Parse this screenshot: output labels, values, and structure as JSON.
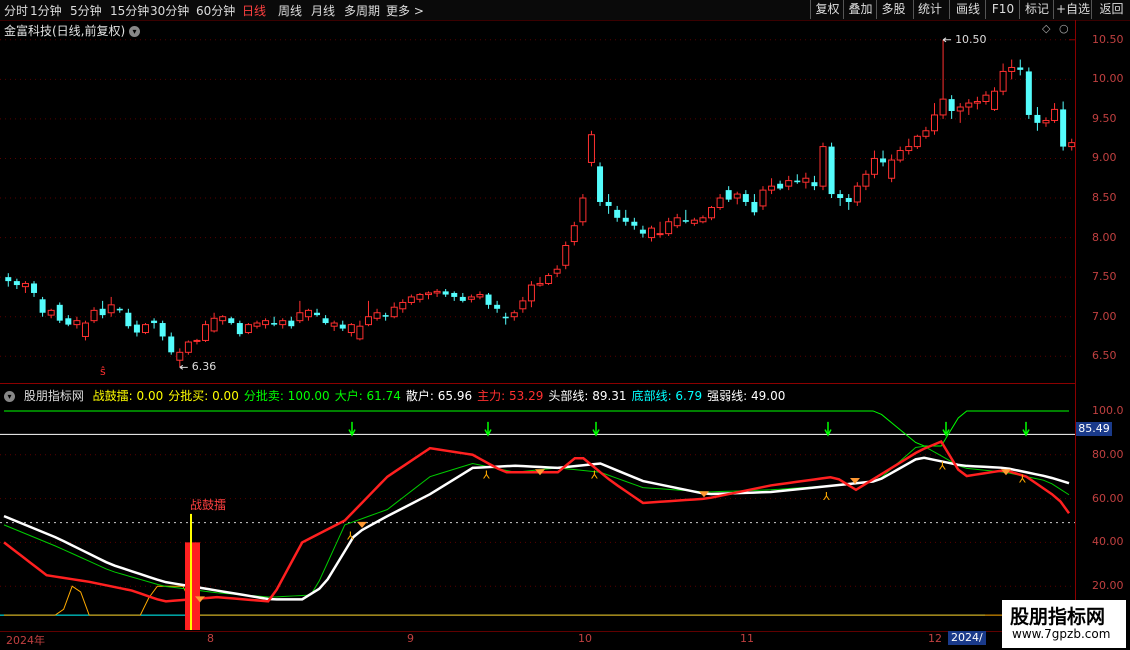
{
  "toolbar": {
    "timeframes": [
      "分时",
      "1分钟",
      "5分钟",
      "15分钟",
      "30分钟",
      "60分钟",
      "日线",
      "周线",
      "月线",
      "多周期",
      "更多 >"
    ],
    "active": "日线",
    "right_buttons": [
      "复权",
      "叠加",
      "多股",
      "统计",
      "画线",
      "F10",
      "标记",
      "+自选",
      "返回"
    ]
  },
  "stock": {
    "title": "金富科技(日线,前复权)",
    "toggle_icon": "chevron-down-icon"
  },
  "price_axis": [
    "10.50",
    "10.00",
    "9.50",
    "9.00",
    "8.50",
    "8.00",
    "7.50",
    "7.00",
    "6.50"
  ],
  "price_annotations": {
    "high": "10.50",
    "low": "6.36"
  },
  "indicator": {
    "name": "股朋指标网",
    "fields": [
      {
        "label": "战鼓擂:",
        "value": "0.00",
        "color": "#ffff00"
      },
      {
        "label": "分批买:",
        "value": "0.00",
        "color": "#ffff00"
      },
      {
        "label": "分批卖:",
        "value": "100.00",
        "color": "#00ff00"
      },
      {
        "label": "大户:",
        "value": "61.74",
        "color": "#00ff00"
      },
      {
        "label": "散户:",
        "value": "65.96",
        "color": "#ffffff"
      },
      {
        "label": "主力:",
        "value": "53.29",
        "color": "#ff3030"
      },
      {
        "label": "头部线:",
        "value": "89.31",
        "color": "#ffffff"
      },
      {
        "label": "底部线:",
        "value": "6.79",
        "color": "#00ffff"
      },
      {
        "label": "强弱线:",
        "value": "49.00",
        "color": "#ffffff"
      }
    ],
    "zhangulei_label": "战鼓擂"
  },
  "indicator_axis": [
    "100.0",
    "80.00",
    "60.00",
    "40.00",
    "20.00"
  ],
  "current_value_badge": "85.49",
  "date_axis": {
    "year": "2024年",
    "months": [
      "8",
      "9",
      "10",
      "11",
      "12"
    ],
    "year_end": "2024/"
  },
  "watermark": {
    "title": "股朋指标网",
    "url": "www.7gpzb.com"
  },
  "colors": {
    "up": "#ff3030",
    "down": "#54fcfc",
    "bg": "#000000",
    "grid": "#8b0000"
  },
  "chart_data": {
    "type": "candlestick",
    "ohlc": [
      [
        7.5,
        7.55,
        7.38,
        7.45
      ],
      [
        7.45,
        7.48,
        7.35,
        7.4
      ],
      [
        7.38,
        7.45,
        7.3,
        7.42
      ],
      [
        7.42,
        7.45,
        7.25,
        7.3
      ],
      [
        7.22,
        7.25,
        7.0,
        7.05
      ],
      [
        7.02,
        7.1,
        6.98,
        7.08
      ],
      [
        7.15,
        7.18,
        6.92,
        6.95
      ],
      [
        6.98,
        7.02,
        6.88,
        6.9
      ],
      [
        6.9,
        7.0,
        6.85,
        6.95
      ],
      [
        6.75,
        6.95,
        6.7,
        6.92
      ],
      [
        6.95,
        7.12,
        6.92,
        7.08
      ],
      [
        7.1,
        7.2,
        6.98,
        7.02
      ],
      [
        7.05,
        7.25,
        7.0,
        7.15
      ],
      [
        7.1,
        7.12,
        7.05,
        7.08
      ],
      [
        7.05,
        7.1,
        6.85,
        6.88
      ],
      [
        6.9,
        6.95,
        6.75,
        6.8
      ],
      [
        6.8,
        6.92,
        6.78,
        6.9
      ],
      [
        6.95,
        6.98,
        6.85,
        6.92
      ],
      [
        6.92,
        6.95,
        6.7,
        6.75
      ],
      [
        6.75,
        6.8,
        6.52,
        6.55
      ],
      [
        6.45,
        6.6,
        6.36,
        6.55
      ],
      [
        6.55,
        6.7,
        6.52,
        6.68
      ],
      [
        6.7,
        6.72,
        6.65,
        6.7
      ],
      [
        6.7,
        6.95,
        6.68,
        6.9
      ],
      [
        6.82,
        7.05,
        6.8,
        6.98
      ],
      [
        6.95,
        7.02,
        6.9,
        7.0
      ],
      [
        6.98,
        7.0,
        6.9,
        6.92
      ],
      [
        6.92,
        6.95,
        6.75,
        6.78
      ],
      [
        6.8,
        6.92,
        6.78,
        6.9
      ],
      [
        6.88,
        6.95,
        6.85,
        6.92
      ],
      [
        6.9,
        6.98,
        6.85,
        6.95
      ],
      [
        6.92,
        7.0,
        6.88,
        6.9
      ],
      [
        6.9,
        6.98,
        6.85,
        6.95
      ],
      [
        6.95,
        7.0,
        6.85,
        6.88
      ],
      [
        6.95,
        7.2,
        6.92,
        7.05
      ],
      [
        7.0,
        7.1,
        6.95,
        7.08
      ],
      [
        7.05,
        7.1,
        7.0,
        7.02
      ],
      [
        6.98,
        7.02,
        6.9,
        6.92
      ],
      [
        6.88,
        6.95,
        6.82,
        6.92
      ],
      [
        6.9,
        6.95,
        6.82,
        6.85
      ],
      [
        6.8,
        6.92,
        6.75,
        6.9
      ],
      [
        6.72,
        6.95,
        6.7,
        6.88
      ],
      [
        6.9,
        7.2,
        6.88,
        7.0
      ],
      [
        6.98,
        7.1,
        6.95,
        7.05
      ],
      [
        7.02,
        7.05,
        6.95,
        7.0
      ],
      [
        7.0,
        7.18,
        6.98,
        7.12
      ],
      [
        7.1,
        7.22,
        7.05,
        7.18
      ],
      [
        7.18,
        7.28,
        7.15,
        7.25
      ],
      [
        7.22,
        7.3,
        7.18,
        7.28
      ],
      [
        7.28,
        7.32,
        7.22,
        7.3
      ],
      [
        7.3,
        7.35,
        7.25,
        7.32
      ],
      [
        7.32,
        7.35,
        7.25,
        7.28
      ],
      [
        7.3,
        7.32,
        7.2,
        7.25
      ],
      [
        7.25,
        7.3,
        7.18,
        7.2
      ],
      [
        7.22,
        7.28,
        7.18,
        7.25
      ],
      [
        7.25,
        7.32,
        7.22,
        7.28
      ],
      [
        7.28,
        7.3,
        7.1,
        7.15
      ],
      [
        7.15,
        7.2,
        7.05,
        7.1
      ],
      [
        7.0,
        7.05,
        6.9,
        6.98
      ],
      [
        7.0,
        7.08,
        6.95,
        7.05
      ],
      [
        7.1,
        7.25,
        7.05,
        7.2
      ],
      [
        7.2,
        7.45,
        7.12,
        7.4
      ],
      [
        7.4,
        7.5,
        7.38,
        7.42
      ],
      [
        7.42,
        7.55,
        7.4,
        7.52
      ],
      [
        7.55,
        7.65,
        7.5,
        7.6
      ],
      [
        7.65,
        7.95,
        7.6,
        7.9
      ],
      [
        7.95,
        8.2,
        7.9,
        8.15
      ],
      [
        8.2,
        8.55,
        8.15,
        8.5
      ],
      [
        8.95,
        9.35,
        8.9,
        9.3
      ],
      [
        8.9,
        8.95,
        8.4,
        8.45
      ],
      [
        8.45,
        8.55,
        8.3,
        8.4
      ],
      [
        8.35,
        8.4,
        8.2,
        8.25
      ],
      [
        8.25,
        8.35,
        8.15,
        8.2
      ],
      [
        8.2,
        8.25,
        8.1,
        8.15
      ],
      [
        8.1,
        8.15,
        8.0,
        8.05
      ],
      [
        8.0,
        8.15,
        7.95,
        8.12
      ],
      [
        8.05,
        8.2,
        8.0,
        8.05
      ],
      [
        8.05,
        8.25,
        8.02,
        8.2
      ],
      [
        8.15,
        8.3,
        8.12,
        8.25
      ],
      [
        8.22,
        8.35,
        8.18,
        8.2
      ],
      [
        8.18,
        8.25,
        8.15,
        8.22
      ],
      [
        8.2,
        8.28,
        8.18,
        8.25
      ],
      [
        8.25,
        8.4,
        8.22,
        8.38
      ],
      [
        8.38,
        8.55,
        8.35,
        8.5
      ],
      [
        8.6,
        8.65,
        8.45,
        8.48
      ],
      [
        8.5,
        8.58,
        8.42,
        8.55
      ],
      [
        8.55,
        8.6,
        8.4,
        8.45
      ],
      [
        8.45,
        8.55,
        8.28,
        8.32
      ],
      [
        8.4,
        8.65,
        8.35,
        8.6
      ],
      [
        8.6,
        8.75,
        8.55,
        8.65
      ],
      [
        8.68,
        8.72,
        8.6,
        8.62
      ],
      [
        8.65,
        8.78,
        8.6,
        8.72
      ],
      [
        8.72,
        8.8,
        8.68,
        8.7
      ],
      [
        8.7,
        8.82,
        8.62,
        8.75
      ],
      [
        8.7,
        8.78,
        8.6,
        8.65
      ],
      [
        8.65,
        9.2,
        8.6,
        9.15
      ],
      [
        9.15,
        9.2,
        8.5,
        8.55
      ],
      [
        8.55,
        8.6,
        8.4,
        8.5
      ],
      [
        8.5,
        8.55,
        8.35,
        8.45
      ],
      [
        8.45,
        8.7,
        8.4,
        8.65
      ],
      [
        8.65,
        8.85,
        8.6,
        8.8
      ],
      [
        8.8,
        9.1,
        8.75,
        9.0
      ],
      [
        9.0,
        9.1,
        8.9,
        8.95
      ],
      [
        8.75,
        9.05,
        8.7,
        8.98
      ],
      [
        8.98,
        9.15,
        8.95,
        9.1
      ],
      [
        9.1,
        9.25,
        9.05,
        9.15
      ],
      [
        9.15,
        9.3,
        9.12,
        9.28
      ],
      [
        9.28,
        9.4,
        9.25,
        9.35
      ],
      [
        9.35,
        9.7,
        9.3,
        9.55
      ],
      [
        9.55,
        10.5,
        9.5,
        9.75
      ],
      [
        9.75,
        9.8,
        9.5,
        9.6
      ],
      [
        9.6,
        9.7,
        9.45,
        9.65
      ],
      [
        9.65,
        9.75,
        9.55,
        9.7
      ],
      [
        9.7,
        9.78,
        9.62,
        9.72
      ],
      [
        9.72,
        9.85,
        9.68,
        9.8
      ],
      [
        9.62,
        9.9,
        9.6,
        9.85
      ],
      [
        9.85,
        10.2,
        9.8,
        10.1
      ],
      [
        10.1,
        10.25,
        10.0,
        10.15
      ],
      [
        10.15,
        10.25,
        10.05,
        10.12
      ],
      [
        10.1,
        10.15,
        9.5,
        9.55
      ],
      [
        9.55,
        9.65,
        9.35,
        9.45
      ],
      [
        9.45,
        9.52,
        9.4,
        9.48
      ],
      [
        9.48,
        9.7,
        9.45,
        9.62
      ],
      [
        9.62,
        9.72,
        9.1,
        9.15
      ],
      [
        9.15,
        9.25,
        9.1,
        9.2
      ]
    ],
    "ylim": [
      6.2,
      10.75
    ],
    "indicator_ylim": [
      0,
      105
    ]
  }
}
